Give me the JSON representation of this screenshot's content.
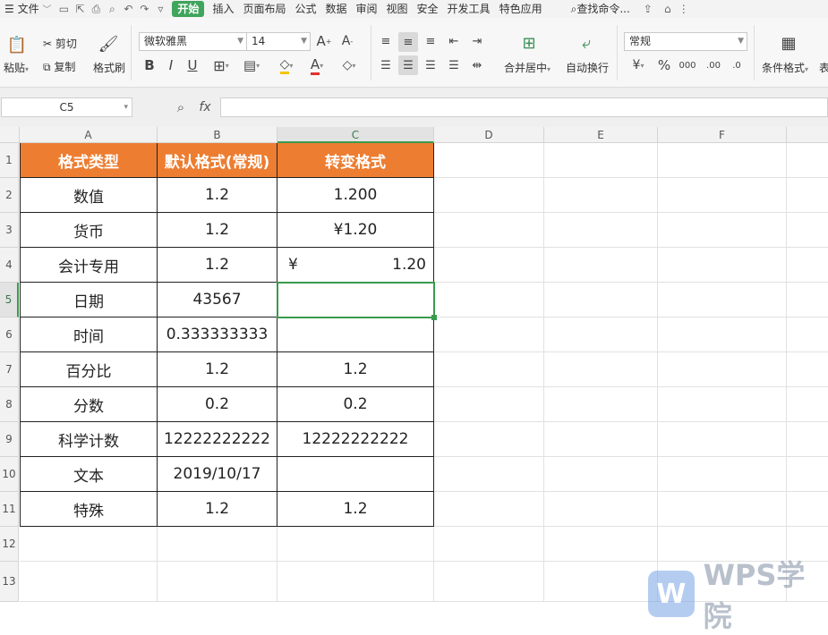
{
  "menubar": {
    "file": "文件",
    "tabs": [
      "开始",
      "插入",
      "页面布局",
      "公式",
      "数据",
      "审阅",
      "视图",
      "安全",
      "开发工具",
      "特色应用"
    ],
    "active_tab": "开始",
    "search": "查找命令..."
  },
  "ribbon": {
    "paste": "粘贴",
    "cut": "剪切",
    "copy": "复制",
    "format_painter": "格式刷",
    "font_name": "微软雅黑",
    "font_size": "14",
    "merge_center": "合并居中",
    "wrap_text": "自动换行",
    "number_format": "常规",
    "conditional_format": "条件格式",
    "table_style_partial": "表"
  },
  "formula_bar": {
    "name_box": "C5",
    "fx": "fx",
    "content": ""
  },
  "sheet": {
    "columns": [
      "A",
      "B",
      "C",
      "D",
      "E",
      "F"
    ],
    "rows": [
      "1",
      "2",
      "3",
      "4",
      "5",
      "6",
      "7",
      "8",
      "9",
      "10",
      "11",
      "12",
      "13"
    ],
    "selected_cell": "C5",
    "header": [
      "格式类型",
      "默认格式(常规)",
      "转变格式"
    ],
    "data": [
      [
        "数值",
        "1.2",
        "1.200"
      ],
      [
        "货币",
        "1.2",
        "¥1.20"
      ],
      [
        "会计专用",
        "1.2",
        "¥|1.20"
      ],
      [
        "日期",
        "43567",
        ""
      ],
      [
        "时间",
        "0.333333333",
        ""
      ],
      [
        "百分比",
        "1.2",
        "1.2"
      ],
      [
        "分数",
        "0.2",
        "0.2"
      ],
      [
        "科学计数",
        "12222222222",
        "12222222222"
      ],
      [
        "文本",
        "2019/10/17",
        ""
      ],
      [
        "特殊",
        "1.2",
        "1.2"
      ]
    ],
    "header_color": "#ED7D31"
  },
  "watermark": "WPS学院"
}
